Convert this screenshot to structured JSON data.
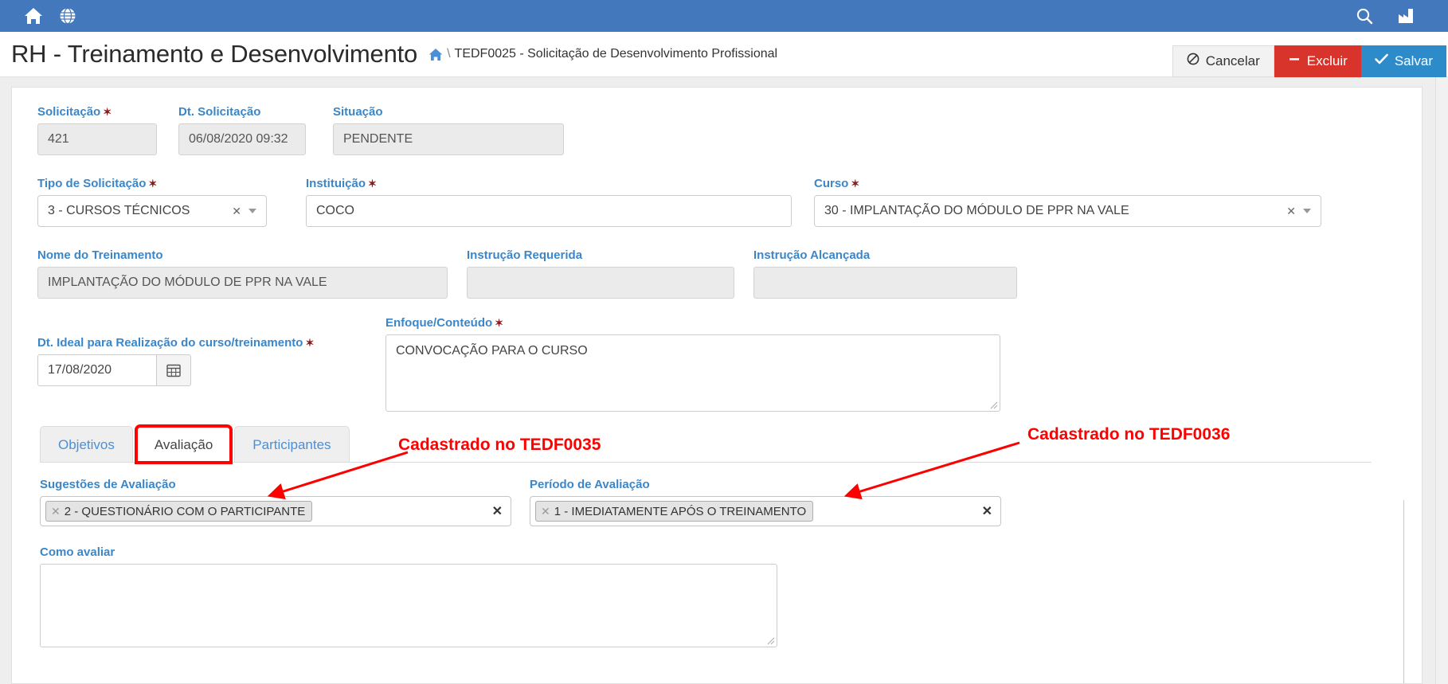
{
  "topbar": {
    "home_icon": "home-icon",
    "globe_icon": "globe-icon",
    "search_icon": "search-icon",
    "factory_icon": "factory-icon",
    "bg_color": "#4378bd"
  },
  "header": {
    "title": "RH - Treinamento e Desenvolvimento",
    "breadcrumb_home_icon": "home-icon",
    "breadcrumb_separator": "\\",
    "breadcrumb_text": "TEDF0025 - Solicitação de Desenvolvimento Profissional",
    "actions": {
      "cancel_label": "Cancelar",
      "cancel_icon": "ban-icon",
      "delete_label": "Excluir",
      "delete_icon": "minus-icon",
      "save_label": "Salvar",
      "save_icon": "check-icon",
      "delete_color": "#d9342b",
      "save_color": "#2e8bc9"
    }
  },
  "form": {
    "solicitacao": {
      "label": "Solicitação",
      "required": true,
      "value": "421",
      "readonly": true
    },
    "dt_solicitacao": {
      "label": "Dt. Solicitação",
      "required": false,
      "value": "06/08/2020 09:32",
      "readonly": true
    },
    "situacao": {
      "label": "Situação",
      "required": false,
      "value": "PENDENTE",
      "readonly": true
    },
    "tipo_solicitacao": {
      "label": "Tipo de Solicitação",
      "required": true,
      "value": "3 - CURSOS TÉCNICOS",
      "clear_icon": "clear-x-icon",
      "dropdown_icon": "chevron-down-icon"
    },
    "instituicao": {
      "label": "Instituição",
      "required": true,
      "value": "COCO"
    },
    "curso": {
      "label": "Curso",
      "required": true,
      "value": "30 - IMPLANTAÇÃO DO MÓDULO DE PPR NA VALE",
      "clear_icon": "clear-x-icon",
      "dropdown_icon": "chevron-down-icon"
    },
    "nome_treinamento": {
      "label": "Nome do Treinamento",
      "required": false,
      "value": "IMPLANTAÇÃO DO MÓDULO DE PPR NA VALE",
      "readonly": true
    },
    "instrucao_requerida": {
      "label": "Instrução Requerida",
      "required": false,
      "value": "",
      "readonly": true
    },
    "instrucao_alcancada": {
      "label": "Instrução Alcançada",
      "required": false,
      "value": "",
      "readonly": true
    },
    "dt_ideal": {
      "label": "Dt. Ideal para Realização do curso/treinamento",
      "required": true,
      "value": "17/08/2020",
      "calendar_icon": "calendar-icon"
    },
    "enfoque": {
      "label": "Enfoque/Conteúdo",
      "required": true,
      "value": "CONVOCAÇÃO PARA O CURSO"
    }
  },
  "tabs": [
    {
      "label": "Objetivos",
      "active": false,
      "highlighted": false
    },
    {
      "label": "Avaliação",
      "active": true,
      "highlighted": true
    },
    {
      "label": "Participantes",
      "active": false,
      "highlighted": false
    }
  ],
  "panel": {
    "sugestoes": {
      "label": "Sugestões de Avaliação",
      "token": "2 - QUESTIONÁRIO COM O PARTICIPANTE",
      "token_remove_icon": "token-x-icon",
      "clear_icon": "clear-x-icon"
    },
    "periodo": {
      "label": "Período de Avaliação",
      "token": "1 - IMEDIATAMENTE APÓS O TREINAMENTO",
      "token_remove_icon": "token-x-icon",
      "clear_icon": "clear-x-icon"
    },
    "como_avaliar": {
      "label": "Como avaliar",
      "value": ""
    }
  },
  "annotations": [
    {
      "text": "Cadastrado no TEDF0035",
      "color": "#ff0000"
    },
    {
      "text": "Cadastrado no TEDF0036",
      "color": "#ff0000"
    }
  ],
  "theme": {
    "label_blue": "#3b86c8",
    "required_red": "#8b1a1a",
    "annotation_red": "#ff0000",
    "page_bg": "#eeeeee"
  }
}
